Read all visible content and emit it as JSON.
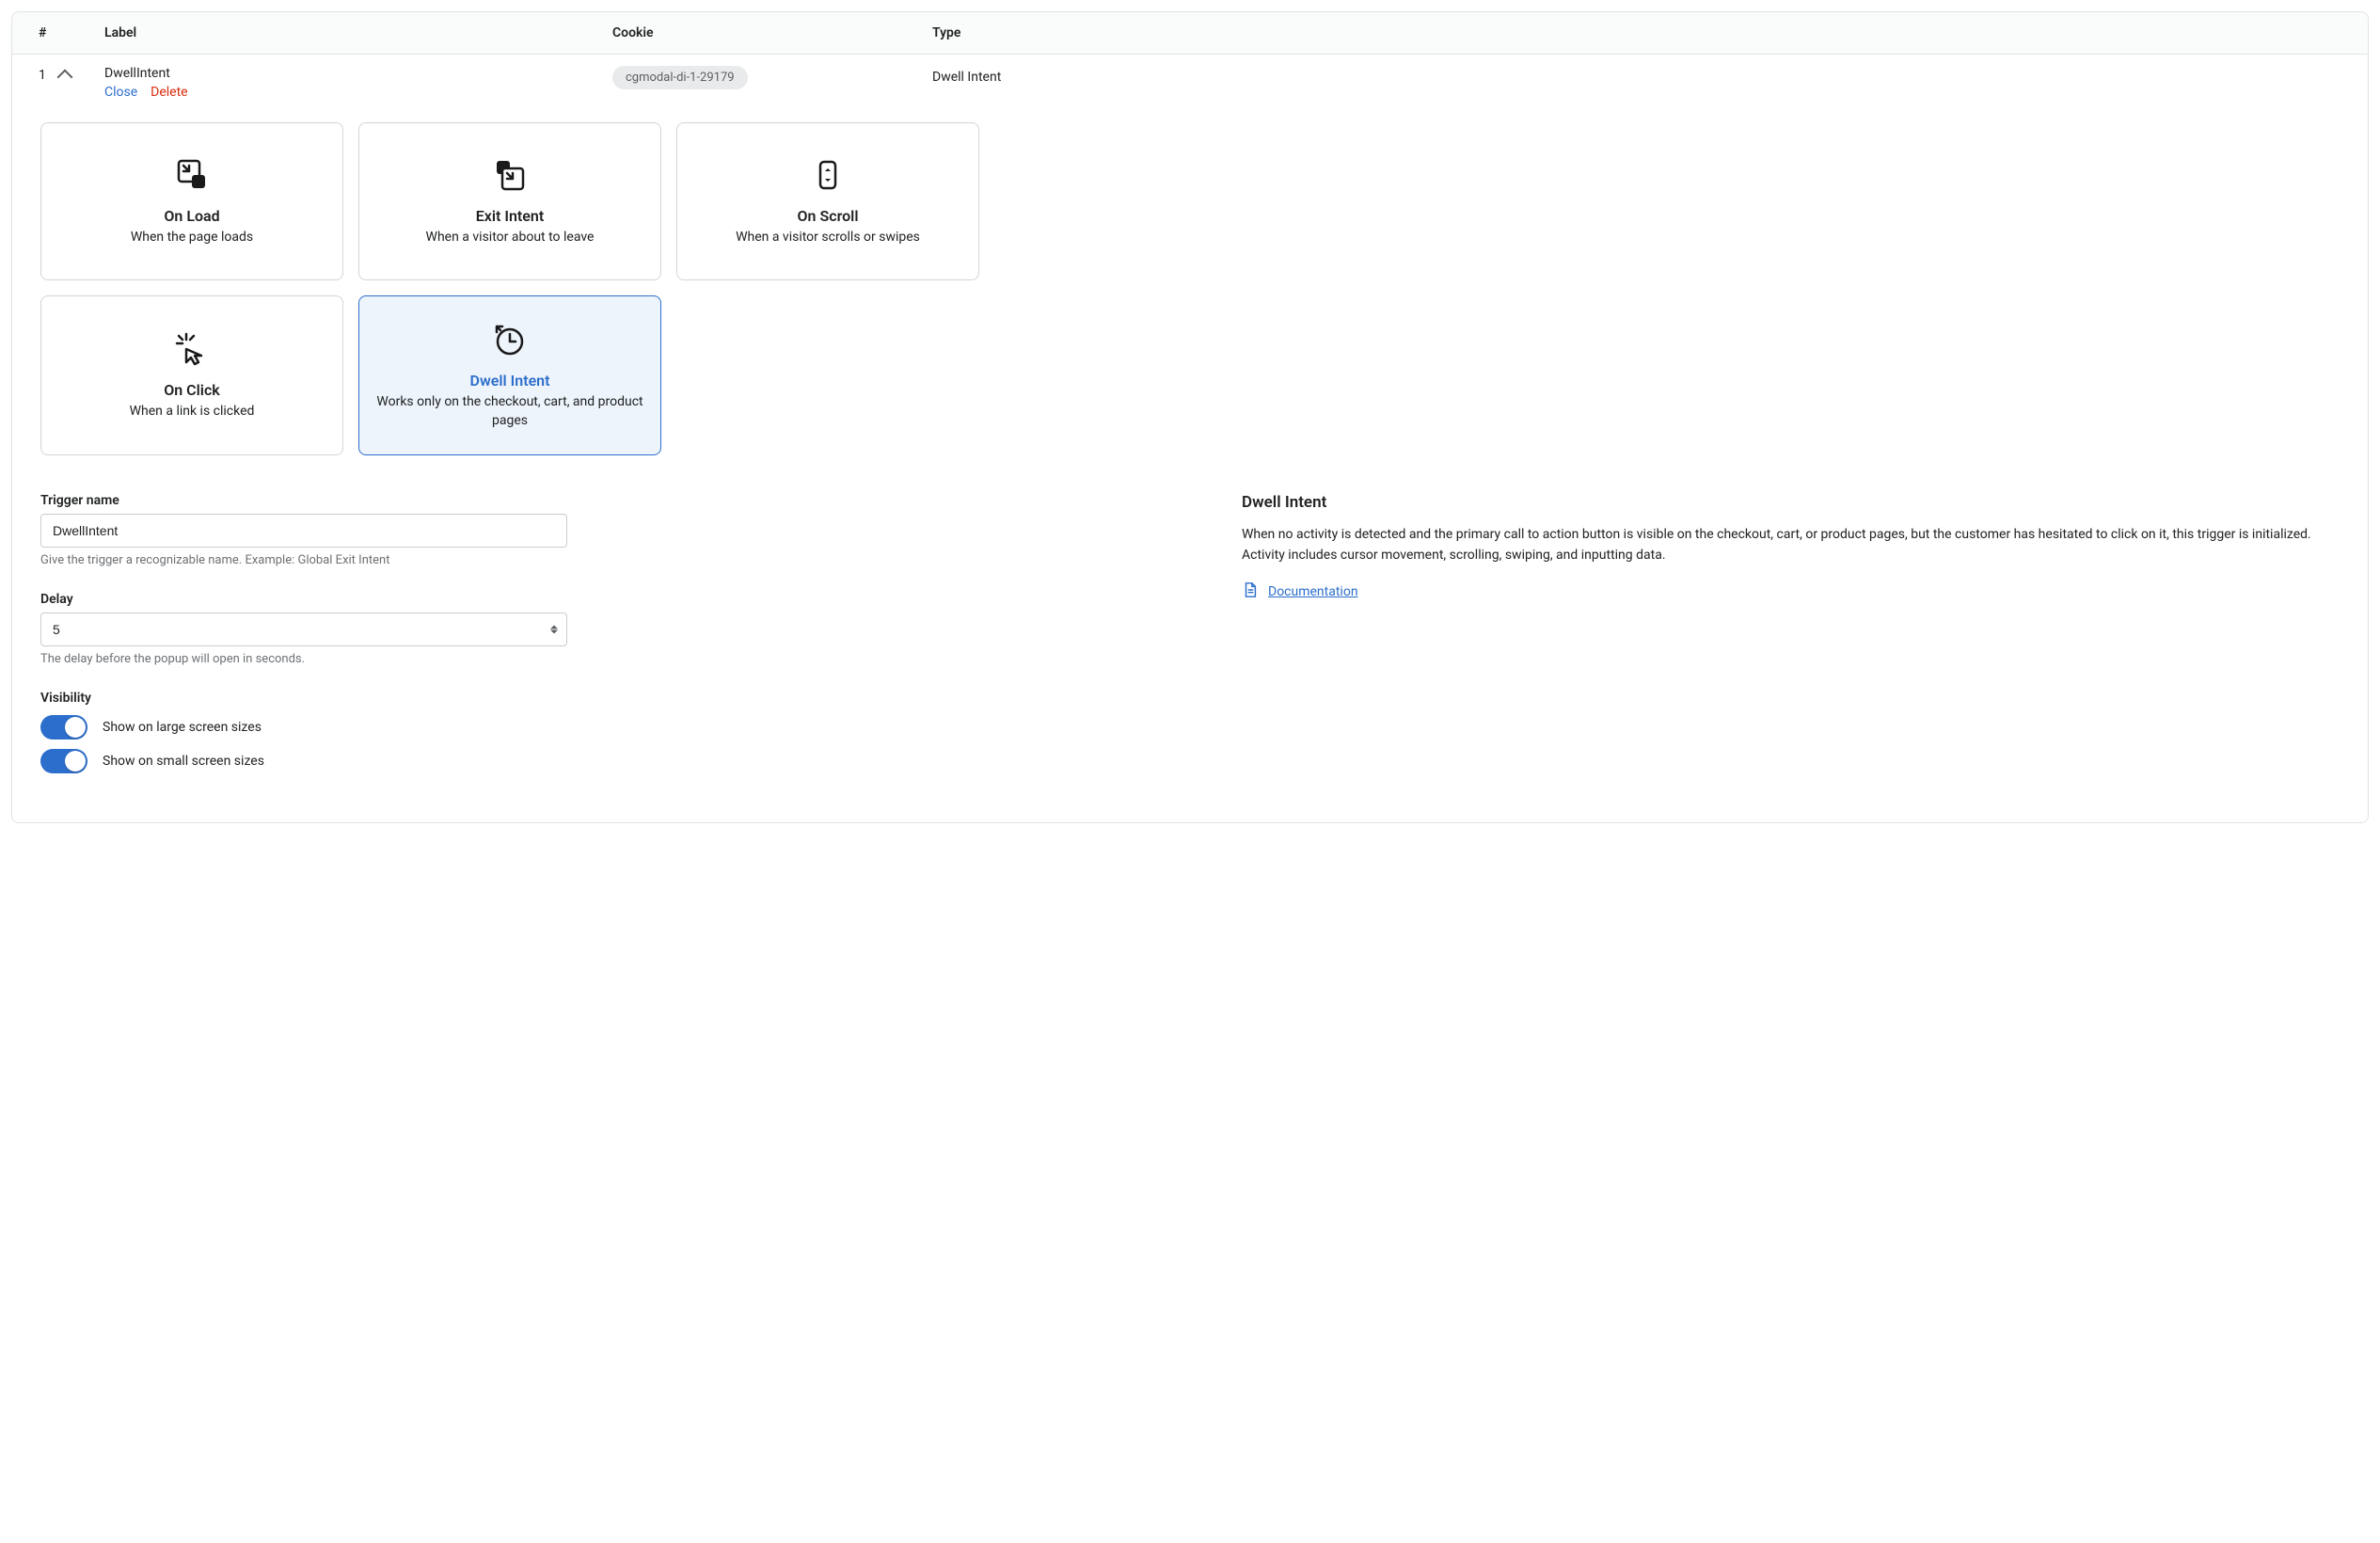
{
  "table": {
    "headers": {
      "num": "#",
      "label": "Label",
      "cookie": "Cookie",
      "type": "Type"
    },
    "row": {
      "index": "1",
      "label": "DwellIntent",
      "close": "Close",
      "delete": "Delete",
      "cookie": "cgmodal-di-1-29179",
      "type": "Dwell Intent"
    }
  },
  "triggers": [
    {
      "title": "On Load",
      "desc": "When the page loads",
      "selected": false
    },
    {
      "title": "Exit Intent",
      "desc": "When a visitor about to leave",
      "selected": false
    },
    {
      "title": "On Scroll",
      "desc": "When a visitor scrolls or swipes",
      "selected": false
    },
    {
      "title": "On Click",
      "desc": "When a link is clicked",
      "selected": false
    },
    {
      "title": "Dwell Intent",
      "desc": "Works only on the checkout, cart, and product pages",
      "selected": true
    }
  ],
  "form": {
    "triggerName": {
      "label": "Trigger name",
      "value": "DwellIntent",
      "help": "Give the trigger a recognizable name. Example: Global Exit Intent"
    },
    "delay": {
      "label": "Delay",
      "value": "5",
      "help": "The delay before the popup will open in seconds."
    },
    "visibility": {
      "label": "Visibility",
      "large": {
        "label": "Show on large screen sizes",
        "on": true
      },
      "small": {
        "label": "Show on small screen sizes",
        "on": true
      }
    }
  },
  "info": {
    "title": "Dwell Intent",
    "body": "When no activity is detected and the primary call to action button is visible on the checkout, cart, or product pages, but the customer has hesitated to click on it, this trigger is initialized. Activity includes cursor movement, scrolling, swiping, and inputting data.",
    "doc": "Documentation"
  }
}
